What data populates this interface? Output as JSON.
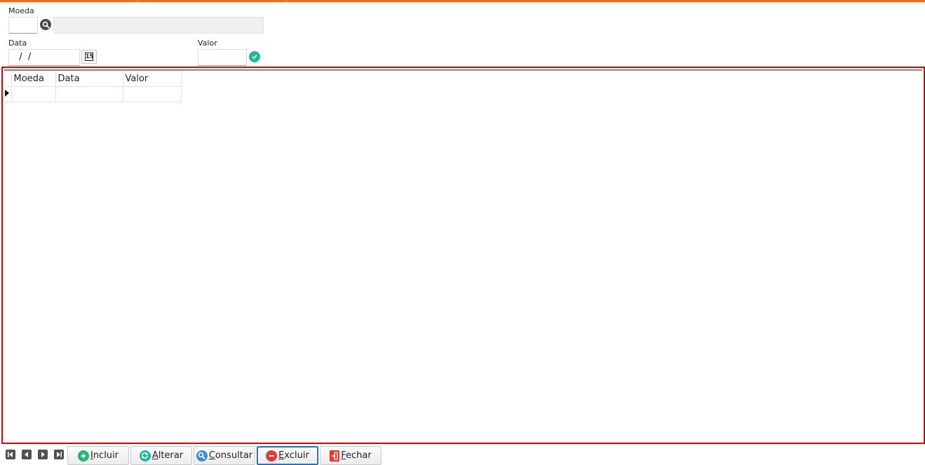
{
  "form": {
    "moeda_label": "Moeda",
    "moeda_code_value": "",
    "moeda_description_value": "",
    "data_label": "Data",
    "data_value": "  /  /",
    "calendar_glyph": "15",
    "valor_label": "Valor",
    "valor_value": ""
  },
  "grid": {
    "columns": [
      "Moeda",
      "Data",
      "Valor"
    ],
    "rows": [
      {
        "moeda": "",
        "data": "",
        "valor": ""
      }
    ]
  },
  "toolbar": {
    "incluir": "Incluir",
    "alterar": "Alterar",
    "consultar": "Consultar",
    "excluir": "Excluir",
    "fechar": "Fechar"
  },
  "colors": {
    "accent_top": "#f26a1b",
    "grid_highlight": "#e00000",
    "incluir_icon": "#22b573",
    "alterar_icon": "#1fb79e",
    "consultar_icon": "#3a8fd8",
    "excluir_icon": "#e53935",
    "fechar_icon": "#e53935"
  },
  "icons": {
    "search": "search-icon",
    "calendar": "calendar-icon",
    "confirm": "check-circle-icon",
    "first": "first-record-icon",
    "previous": "previous-record-icon",
    "next": "next-record-icon",
    "last": "last-record-icon"
  }
}
